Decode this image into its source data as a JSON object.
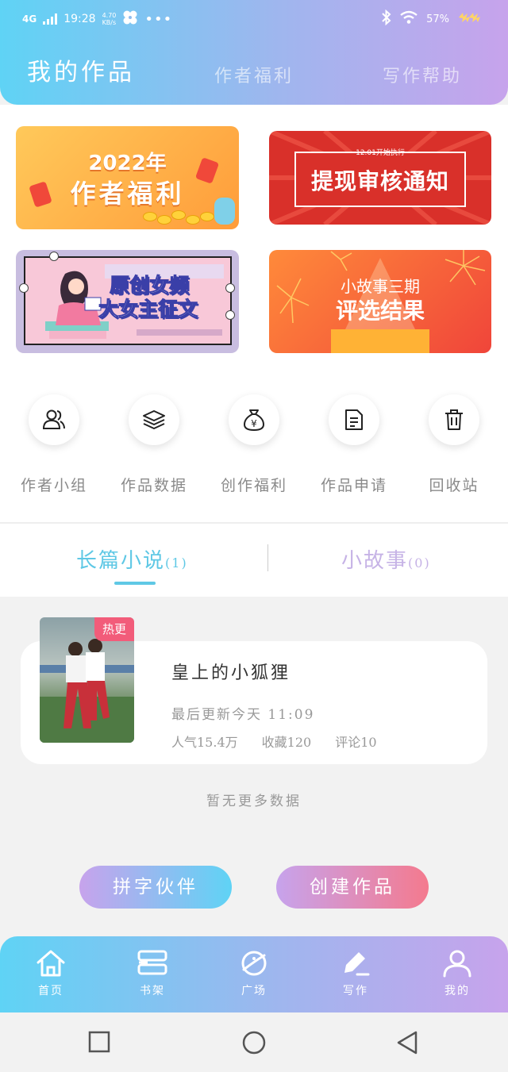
{
  "status_bar": {
    "network": "4G",
    "time": "19:28",
    "speed_value": "4.70",
    "speed_unit": "KB/s",
    "more": "•••",
    "battery": "57%"
  },
  "header": {
    "tabs": [
      {
        "label": "我的作品",
        "active": true
      },
      {
        "label": "作者福利",
        "active": false
      },
      {
        "label": "写作帮助",
        "active": false
      }
    ]
  },
  "banners": [
    {
      "year": "2022年",
      "title": "作者福利"
    },
    {
      "small": "12.01开始执行",
      "title": "提现审核通知"
    },
    {
      "line1": "原创女频",
      "line2": "大女主征文"
    },
    {
      "line1": "小故事三期",
      "line2": "评选结果"
    }
  ],
  "shortcuts": [
    {
      "label": "作者小组",
      "icon": "users-icon"
    },
    {
      "label": "作品数据",
      "icon": "layers-icon"
    },
    {
      "label": "创作福利",
      "icon": "money-bag-icon"
    },
    {
      "label": "作品申请",
      "icon": "document-icon"
    },
    {
      "label": "回收站",
      "icon": "trash-icon"
    }
  ],
  "work_types": {
    "long": {
      "label": "长篇小说",
      "count": "(1)"
    },
    "short": {
      "label": "小故事",
      "count": "(0)"
    }
  },
  "book": {
    "badge": "热更",
    "title": "皇上的小狐狸",
    "update": "最后更新今天 11:09",
    "popularity": "人气15.4万",
    "favorites": "收藏120",
    "comments": "评论10"
  },
  "no_more": "暂无更多数据",
  "buttons": {
    "partner": "拼字伙伴",
    "create": "创建作品"
  },
  "bottom_nav": [
    {
      "label": "首页",
      "icon": "home-icon"
    },
    {
      "label": "书架",
      "icon": "bookshelf-icon"
    },
    {
      "label": "广场",
      "icon": "planet-icon"
    },
    {
      "label": "写作",
      "icon": "write-icon"
    },
    {
      "label": "我的",
      "icon": "profile-icon"
    }
  ],
  "colors": {
    "accent_cyan": "#5fd3f5",
    "accent_purple": "#c7a3ec",
    "accent_pink": "#f47a8e"
  }
}
